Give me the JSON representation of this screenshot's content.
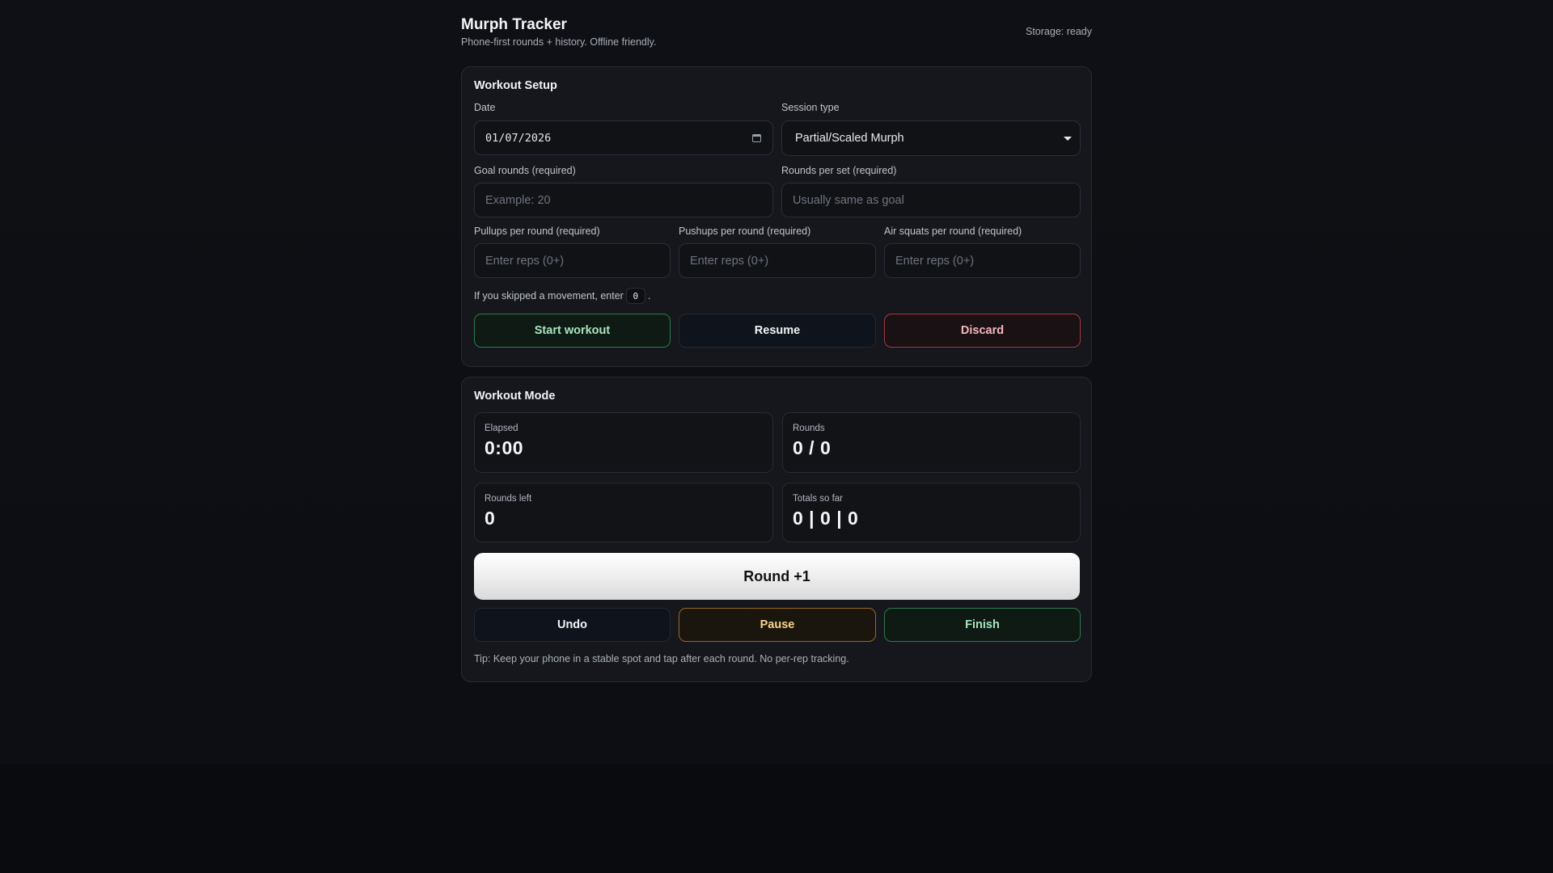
{
  "header": {
    "title": "Murph Tracker",
    "subtitle": "Phone-first rounds + history. Offline friendly.",
    "storage_status": "Storage: ready"
  },
  "setup": {
    "title": "Workout Setup",
    "date": {
      "label": "Date",
      "value": "01/07/2026"
    },
    "session_type": {
      "label": "Session type",
      "value": "Partial/Scaled Murph"
    },
    "goal_rounds": {
      "label": "Goal rounds (required)",
      "placeholder": "Example: 20"
    },
    "rounds_per_set": {
      "label": "Rounds per set (required)",
      "placeholder": "Usually same as goal"
    },
    "pullups": {
      "label": "Pullups per round (required)",
      "placeholder": "Enter reps (0+)"
    },
    "pushups": {
      "label": "Pushups per round (required)",
      "placeholder": "Enter reps (0+)"
    },
    "squats": {
      "label": "Air squats per round (required)",
      "placeholder": "Enter reps (0+)"
    },
    "hint_prefix": "If you skipped a movement, enter",
    "hint_value": "0",
    "hint_suffix": ".",
    "buttons": {
      "start": "Start workout",
      "resume": "Resume",
      "discard": "Discard"
    }
  },
  "mode": {
    "title": "Workout Mode",
    "elapsed": {
      "label": "Elapsed",
      "value": "0:00"
    },
    "rounds": {
      "label": "Rounds",
      "value": "0 / 0"
    },
    "rounds_left": {
      "label": "Rounds left",
      "value": "0"
    },
    "totals": {
      "label": "Totals so far",
      "value": "0 | 0 | 0"
    },
    "round_button": "Round +1",
    "buttons": {
      "undo": "Undo",
      "pause": "Pause",
      "finish": "Finish"
    },
    "tip": "Tip: Keep your phone in a stable spot and tap after each round. No per-rep tracking."
  },
  "colors": {
    "background": "#0e1015",
    "card": "#15171c",
    "success": "#2c7a4e",
    "danger": "#a03a44",
    "warning": "#9a6a1e"
  }
}
